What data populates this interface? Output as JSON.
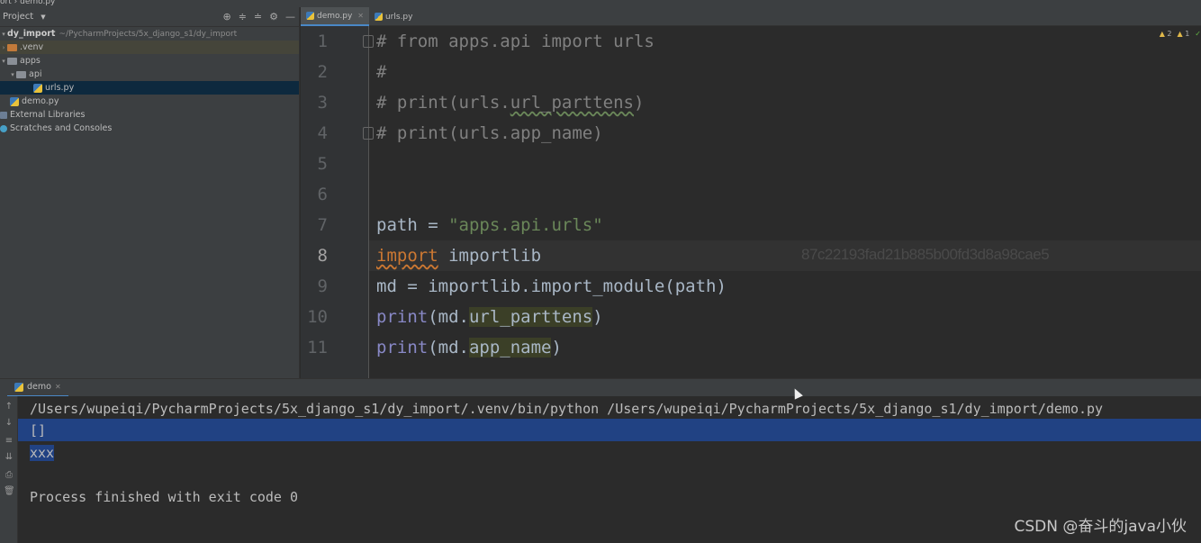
{
  "breadcrumb": {
    "project": "ort",
    "file": "demo.py"
  },
  "project_panel": {
    "title": "Project",
    "root": {
      "name": "dy_import",
      "path": "~/PycharmProjects/5x_django_s1/dy_import"
    },
    "items": [
      {
        "label": ".venv"
      },
      {
        "label": "apps"
      },
      {
        "label": "api"
      },
      {
        "label": "urls.py"
      },
      {
        "label": "demo.py"
      },
      {
        "label": "External Libraries"
      },
      {
        "label": "Scratches and Consoles"
      }
    ]
  },
  "editor_tabs": [
    {
      "label": "demo.py"
    },
    {
      "label": "urls.py"
    }
  ],
  "inspections": {
    "warnings": "2",
    "weak_warnings": "1"
  },
  "editor": {
    "line_numbers": [
      "1",
      "2",
      "3",
      "4",
      "5",
      "6",
      "7",
      "8",
      "9",
      "10",
      "11"
    ],
    "lines": {
      "l1": "# from apps.api import urls",
      "l2": "#",
      "l3a": "# print(urls.",
      "l3b": "url_parttens",
      "l3c": ")",
      "l4": "# print(urls.app_name)",
      "l7a": "path = ",
      "l7b": "\"apps.api.urls\"",
      "l8a": "import",
      "l8b": " importlib",
      "l9": "md = importlib.import_module(path)",
      "l10a": "print",
      "l10b": "(md.",
      "l10c": "url_parttens",
      "l10d": ")",
      "l11a": "print",
      "l11b": "(md.",
      "l11c": "app_name",
      "l11d": ")"
    },
    "hash_overlay": "87c22193fad21b885b00fd3d8a98cae5"
  },
  "run_panel": {
    "tab_label": "demo",
    "output": [
      "/Users/wupeiqi/PycharmProjects/5x_django_s1/dy_import/.venv/bin/python /Users/wupeiqi/PycharmProjects/5x_django_s1/dy_import/demo.py",
      "[]",
      "xxx",
      "Process finished with exit code 0"
    ]
  },
  "watermark": "CSDN @奋斗的java小伙",
  "colors": {
    "keyword": "#cc7832",
    "string": "#6a8759",
    "comment": "#808080",
    "builtin": "#8888c6",
    "selection": "#214283"
  }
}
